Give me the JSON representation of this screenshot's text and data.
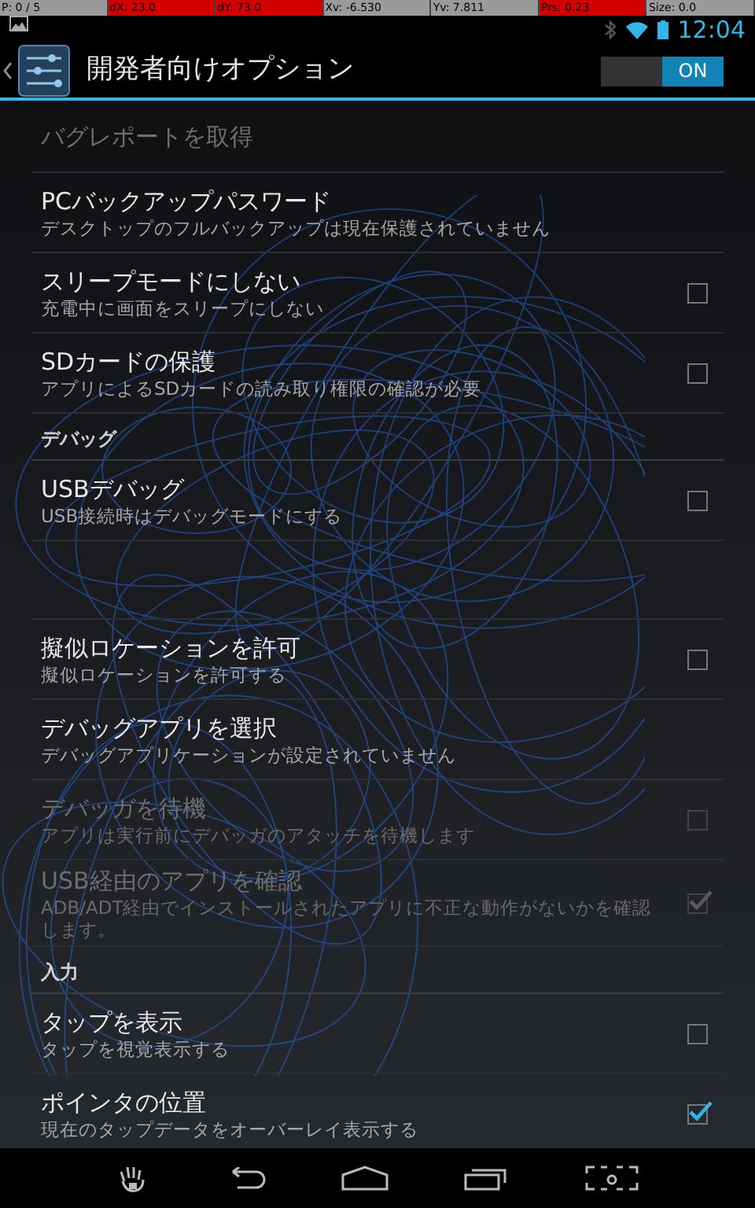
{
  "pointer_bar": [
    {
      "text": "P: 0 / 5",
      "highlight": false
    },
    {
      "text": "dX: 23.0",
      "highlight": true
    },
    {
      "text": "dY: 73.0",
      "highlight": true
    },
    {
      "text": "Xv: -6.530",
      "highlight": false
    },
    {
      "text": "Yv: 7.811",
      "highlight": false
    },
    {
      "text": "Prs: 0.23",
      "highlight": true
    },
    {
      "text": "Size: 0.0",
      "highlight": false
    }
  ],
  "status_bar": {
    "time": "12:04"
  },
  "action_bar": {
    "title": "開発者向けオプション",
    "switch": {
      "label": "ON",
      "on": true
    }
  },
  "rows": [
    {
      "kind": "plain",
      "title": "バグレポートを取得",
      "disabled": true
    },
    {
      "kind": "plain",
      "title": "PCバックアップパスワード",
      "summary": "デスクトップのフルバックアップは現在保護されていません",
      "disabled": false
    },
    {
      "kind": "check",
      "title": "スリープモードにしない",
      "summary": "充電中に画面をスリープにしない",
      "disabled": false,
      "checked": false
    },
    {
      "kind": "check",
      "title": "SDカードの保護",
      "summary": "アプリによるSDカードの読み取り権限の確認が必要",
      "disabled": false,
      "checked": false
    },
    {
      "kind": "header",
      "title": "デバッグ"
    },
    {
      "kind": "check",
      "title": "USBデバッグ",
      "summary": "USB接続時はデバッグモードにする",
      "disabled": false,
      "checked": false
    },
    {
      "kind": "blank"
    },
    {
      "kind": "check",
      "title": "擬似ロケーションを許可",
      "summary": "擬似ロケーションを許可する",
      "disabled": false,
      "checked": false
    },
    {
      "kind": "plain",
      "title": "デバッグアプリを選択",
      "summary": "デバッグアプリケーションが設定されていません",
      "disabled": false
    },
    {
      "kind": "check",
      "title": "デバッガを待機",
      "summary": "アプリは実行前にデバッガのアタッチを待機します",
      "disabled": true,
      "checked": false
    },
    {
      "kind": "check",
      "title": "USB経由のアプリを確認",
      "summary": "ADB/ADT経由でインストールされたアプリに不正な動作がないかを確認します。",
      "disabled": true,
      "checked": true
    },
    {
      "kind": "header",
      "title": "入力"
    },
    {
      "kind": "check",
      "title": "タップを表示",
      "summary": "タップを視覚表示する",
      "disabled": false,
      "checked": false
    },
    {
      "kind": "check",
      "title": "ポインタの位置",
      "summary": "現在のタップデータをオーバーレイ表示する",
      "disabled": false,
      "checked": true
    }
  ]
}
